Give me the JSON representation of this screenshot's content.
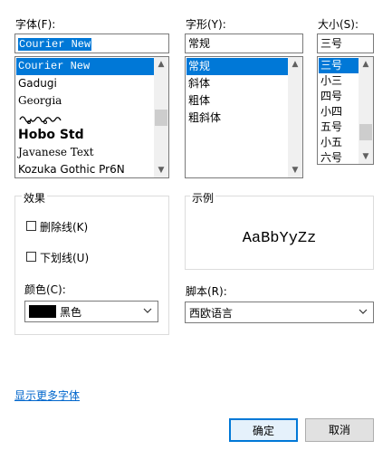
{
  "font": {
    "label": "字体(F):",
    "value": "Courier New",
    "items": [
      "Courier New",
      "Gadugi",
      "Georgia",
      "ශ්‍රීලංකා",
      "Hobo Std",
      "Javanese Text",
      "Kozuka Gothic Pr6N"
    ],
    "selected_index": 0
  },
  "style": {
    "label": "字形(Y):",
    "value": "常规",
    "items": [
      "常规",
      "斜体",
      "粗体",
      "粗斜体"
    ],
    "selected_index": 0
  },
  "size": {
    "label": "大小(S):",
    "value": "三号",
    "items": [
      "三号",
      "小三",
      "四号",
      "小四",
      "五号",
      "小五",
      "六号"
    ],
    "selected_index": 0
  },
  "effects": {
    "label": "效果",
    "strikeout_label": "删除线(K)",
    "strikeout_checked": false,
    "underline_label": "下划线(U)",
    "underline_checked": false,
    "color_label": "颜色(C):",
    "color_value": "黑色",
    "color_swatch": "#000000"
  },
  "sample": {
    "label": "示例",
    "text": "AaBbYyZz"
  },
  "script": {
    "label": "脚本(R):",
    "value": "西欧语言"
  },
  "more_fonts_link": "显示更多字体",
  "buttons": {
    "ok": "确定",
    "cancel": "取消"
  },
  "colors": {
    "selection": "#0078d7",
    "link": "#0066cc",
    "ok_border": "#0078d7"
  }
}
